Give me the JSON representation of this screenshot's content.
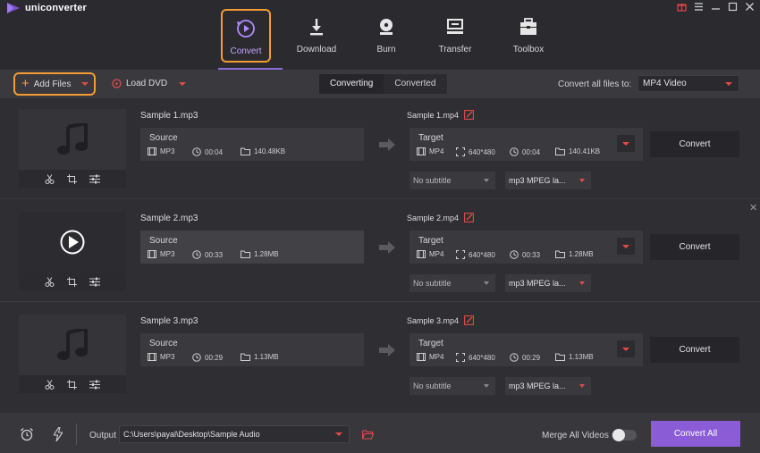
{
  "app": {
    "title": "uniconverter"
  },
  "nav": {
    "tabs": [
      {
        "label": "Convert",
        "icon": "convert-icon",
        "active": true
      },
      {
        "label": "Download",
        "icon": "download-icon"
      },
      {
        "label": "Burn",
        "icon": "burn-icon"
      },
      {
        "label": "Transfer",
        "icon": "transfer-icon"
      },
      {
        "label": "Toolbox",
        "icon": "toolbox-icon"
      }
    ]
  },
  "toolbar": {
    "add_files": "Add Files",
    "load_dvd": "Load DVD",
    "tabs": [
      "Converting",
      "Converted"
    ],
    "convert_all_label": "Convert all files to:",
    "format": "MP4 Video"
  },
  "files": [
    {
      "name": "Sample 1.mp3",
      "source": {
        "title": "Source",
        "format": "MP3",
        "duration": "00:04",
        "size": "140.48KB"
      },
      "target_name": "Sample 1.mp4",
      "target": {
        "title": "Target",
        "format": "MP4",
        "resolution": "640*480",
        "duration": "00:04",
        "size": "140.41KB"
      },
      "subtitle": "No subtitle",
      "audio": "mp3 MPEG la...",
      "convert": "Convert"
    },
    {
      "name": "Sample 2.mp3",
      "source": {
        "title": "Source",
        "format": "MP3",
        "duration": "00:33",
        "size": "1.28MB"
      },
      "target_name": "Sample 2.mp4",
      "target": {
        "title": "Target",
        "format": "MP4",
        "resolution": "640*480",
        "duration": "00:33",
        "size": "1.28MB"
      },
      "subtitle": "No subtitle",
      "audio": "mp3 MPEG la...",
      "convert": "Convert"
    },
    {
      "name": "Sample 3.mp3",
      "source": {
        "title": "Source",
        "format": "MP3",
        "duration": "00:29",
        "size": "1.13MB"
      },
      "target_name": "Sample 3.mp4",
      "target": {
        "title": "Target",
        "format": "MP4",
        "resolution": "640*480",
        "duration": "00:29",
        "size": "1.13MB"
      },
      "subtitle": "No subtitle",
      "audio": "mp3 MPEG la...",
      "convert": "Convert"
    }
  ],
  "bottom": {
    "output_label": "Output",
    "output_path": "C:\\Users\\payal\\Desktop\\Sample Audio",
    "merge_label": "Merge All Videos",
    "convert_all": "Convert All"
  },
  "colors": {
    "accent": "#8a5cd6",
    "highlight": "#f39c33",
    "dropdown_caret": "#e24a4a"
  }
}
